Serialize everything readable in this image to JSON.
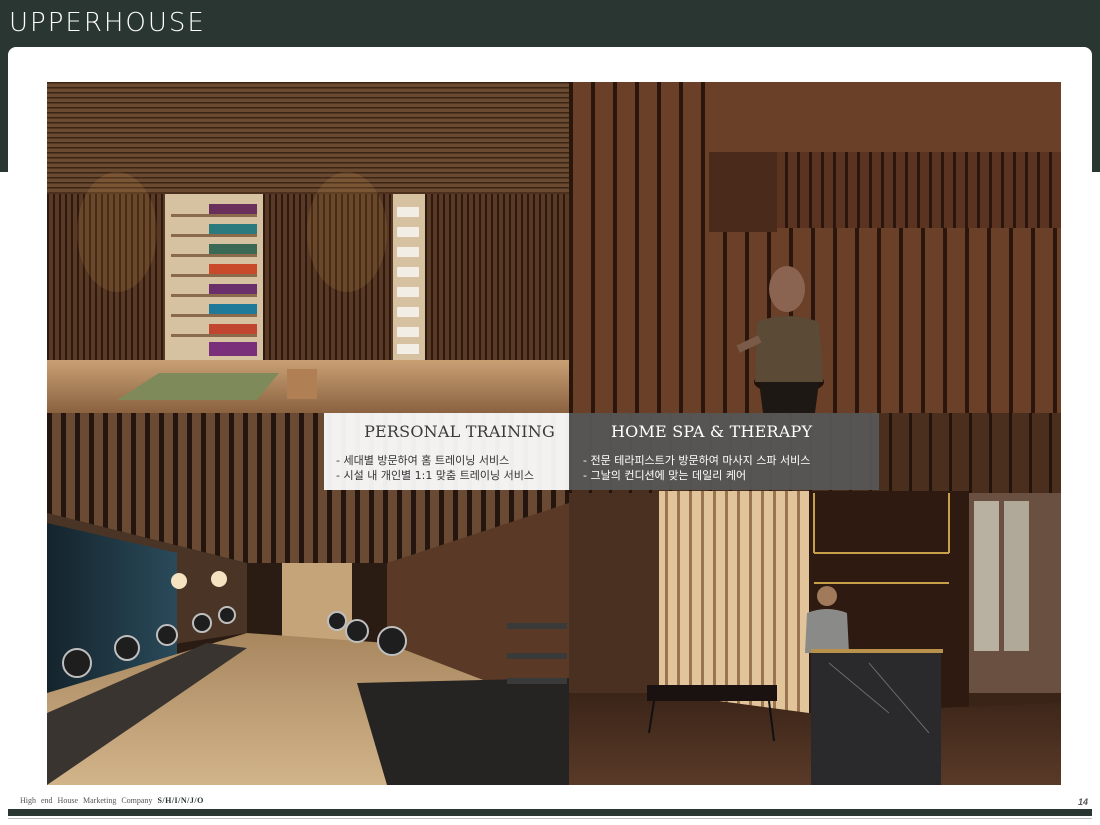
{
  "brand": {
    "name": "UPPERHOUSE"
  },
  "images": {
    "yoga": "yoga-studio-photo",
    "spa": "spa-corridor-photo",
    "gym": "fitness-center-photo",
    "lobby": "spa-reception-photo"
  },
  "captions": {
    "training": {
      "title": "PERSONAL TRAINING",
      "items": [
        "-  세대별 방문하여 홈 트레이닝 서비스",
        "-  시설 내 개인별 1:1 맞춤 트레이닝 서비스"
      ]
    },
    "spa": {
      "title": "HOME SPA & THERAPY",
      "items": [
        "-  전문 테라피스트가 방문하여 마사지 스파 서비스",
        "-  그날의 컨디션에 맞는 데일리 케어"
      ]
    }
  },
  "footer": {
    "company": "High end  House  Marketing  Company",
    "brand_mark": "S/H/I/N/J/O",
    "page": "14"
  },
  "colors": {
    "band": "#2a3631",
    "accent": "#2a3631"
  }
}
